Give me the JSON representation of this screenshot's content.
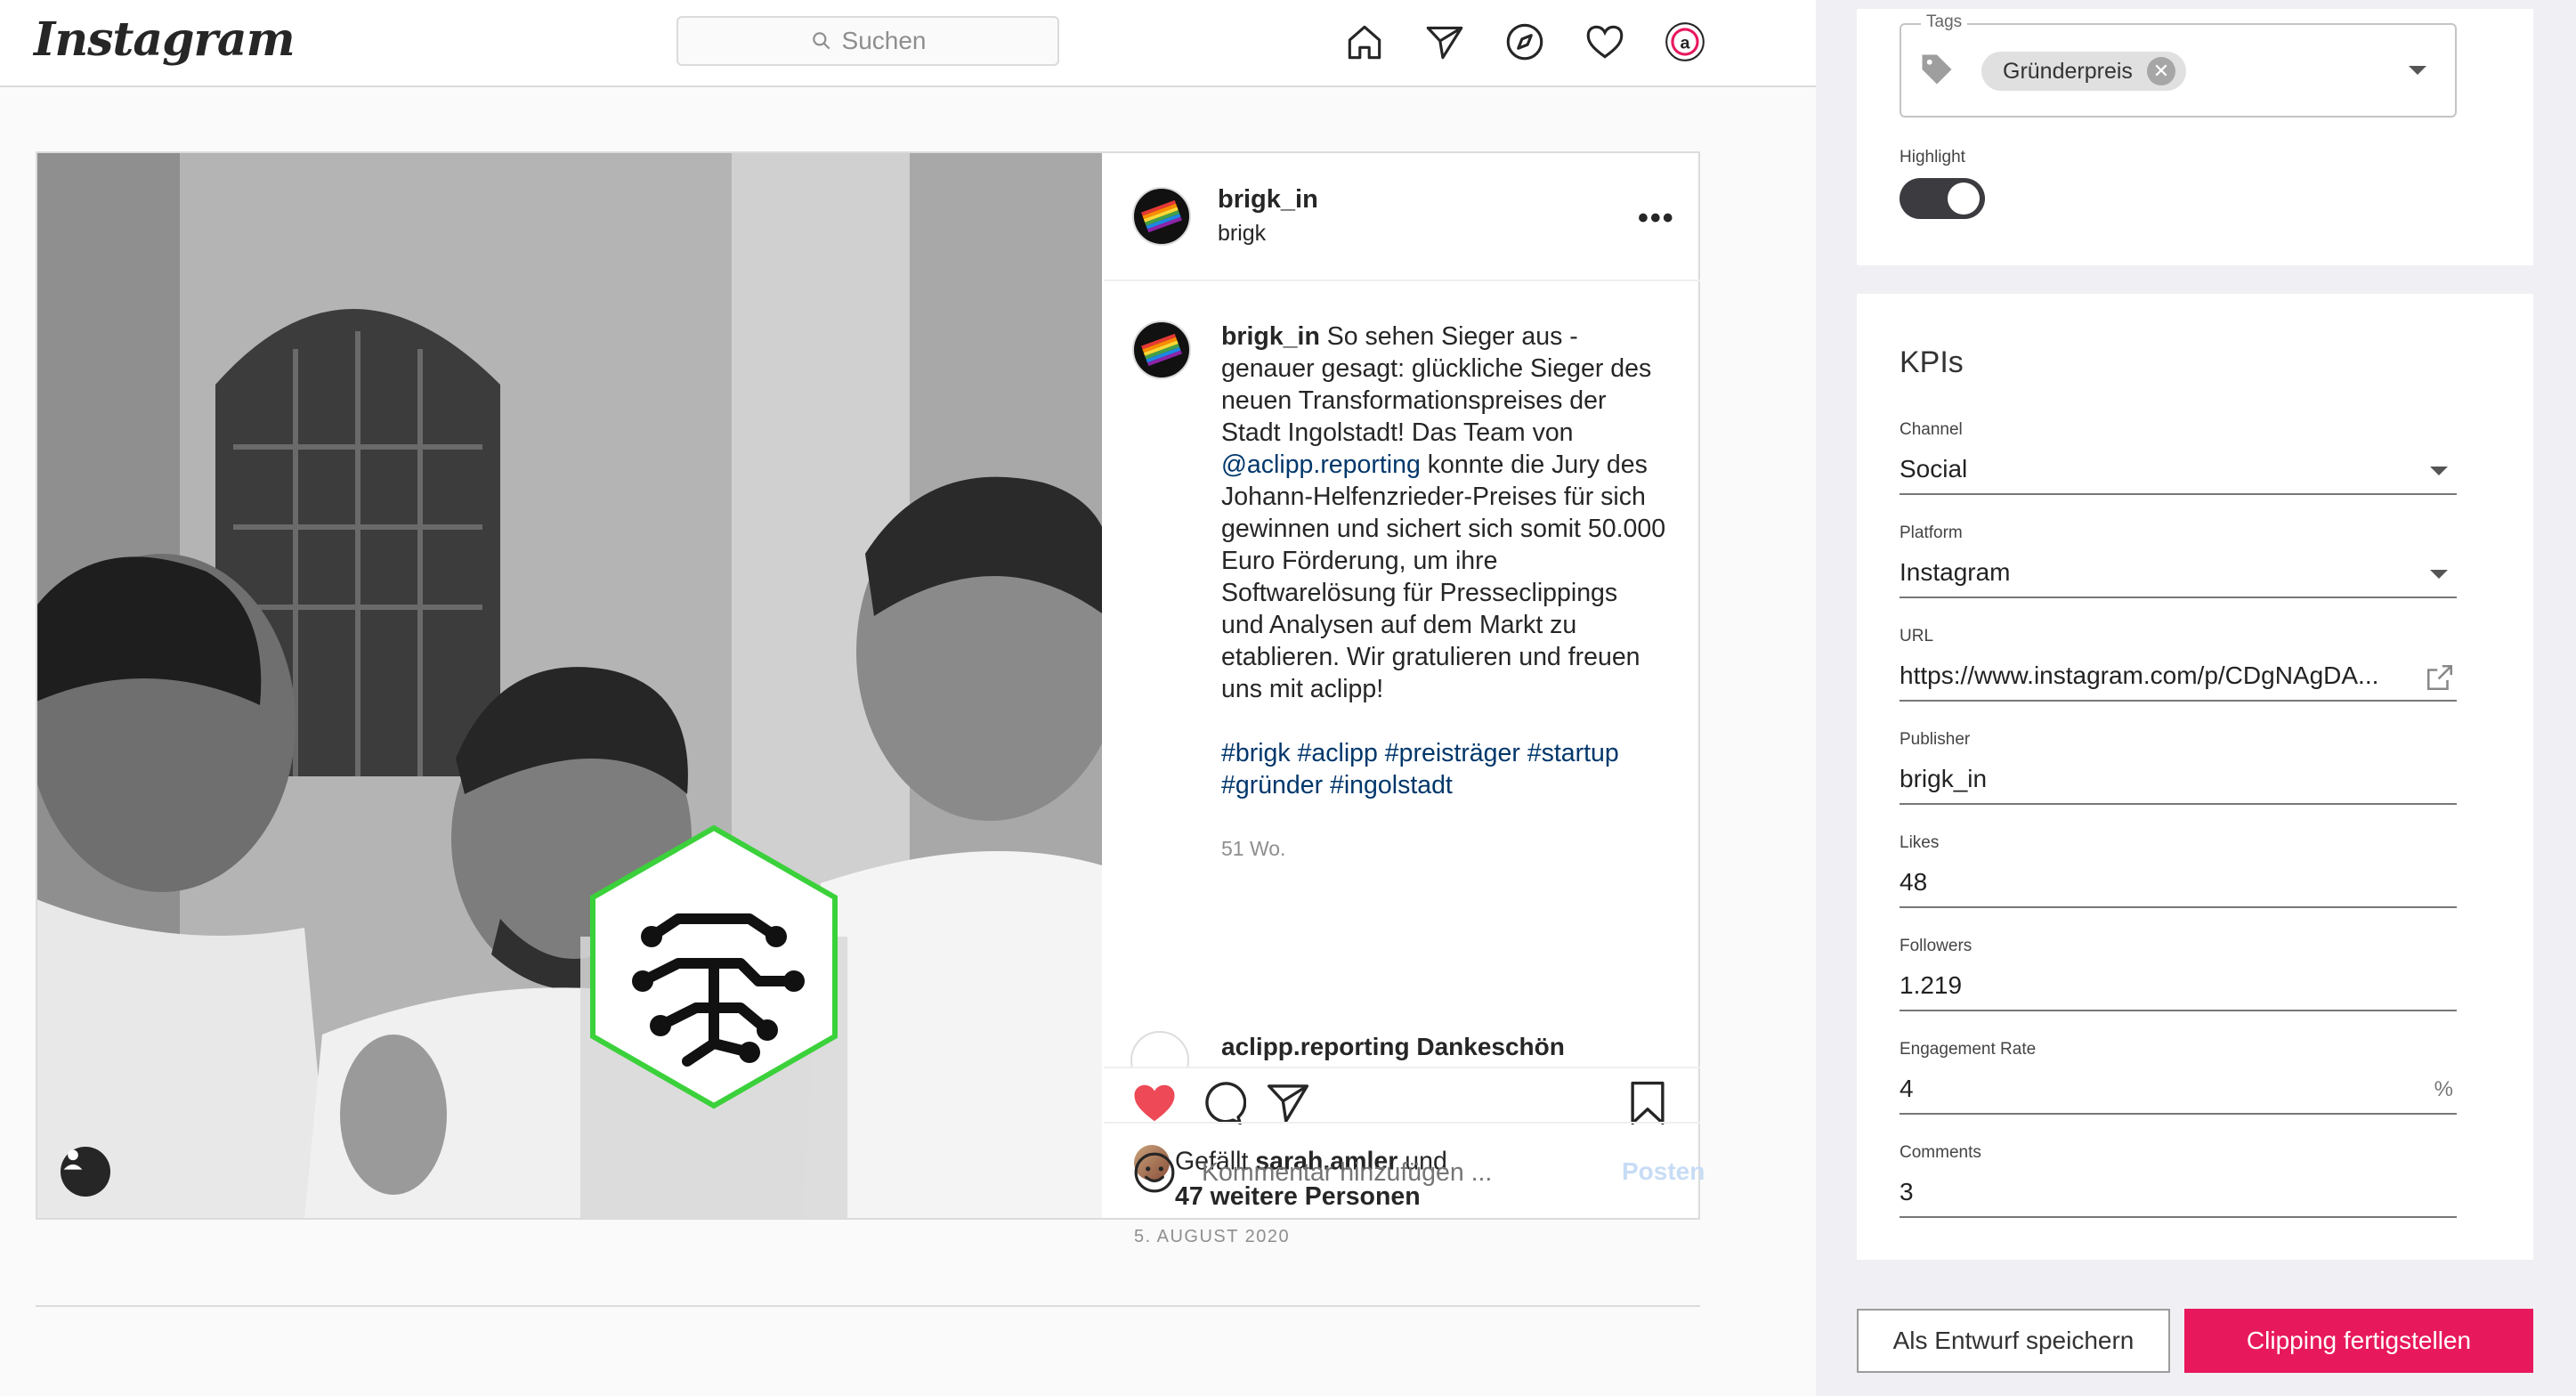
{
  "instagram": {
    "logo": "Instagram",
    "search_placeholder": "Suchen",
    "nav_icons": [
      "home-icon",
      "direct-icon",
      "explore-icon",
      "activity-icon",
      "profile-icon"
    ]
  },
  "post": {
    "username": "brigk_in",
    "location": "brigk",
    "more": "•••",
    "caption": {
      "user": "brigk_in",
      "text_1": " So sehen Sieger aus - genauer gesagt: glückliche Sieger des neuen Transformationspreises der Stadt Ingolstadt! Das Team von ",
      "mention": "@aclipp.reporting",
      "text_2": " konnte die Jury des Johann-Helfenzrieder-Preises für sich gewinnen und sichert sich somit 50.000 Euro Förderung, um ihre Softwarelösung für Presseclippings und Analysen auf dem Markt zu etablieren. Wir gratulieren und freuen uns mit aclipp!",
      "hashtags": "#brigk #aclipp #preisträger #startup #gründer #ingolstadt",
      "age": "51 Wo."
    },
    "next_comment": "aclipp.reporting Dankeschön",
    "likes_prefix": "Gefällt ",
    "likes_user": "sarah.amler",
    "likes_mid": " und",
    "likes_rest": "47 weitere Personen",
    "date": "5. AUGUST 2020",
    "comment_placeholder": "Kommentar hinzufügen ...",
    "post_button": "Posten"
  },
  "panel": {
    "tags_label": "Tags",
    "tag_chip": "Gründerpreis",
    "highlight_label": "Highlight",
    "highlight_on": true,
    "kpi_title": "KPIs",
    "fields": [
      {
        "label": "Channel",
        "value": "Social"
      },
      {
        "label": "Platform",
        "value": "Instagram"
      },
      {
        "label": "URL",
        "value": "https://www.instagram.com/p/CDgNAgDA..."
      },
      {
        "label": "Publisher",
        "value": "brigk_in"
      },
      {
        "label": "Likes",
        "value": "48"
      },
      {
        "label": "Followers",
        "value": "1.219"
      },
      {
        "label": "Engagement Rate",
        "value": "4",
        "suffix": "%"
      },
      {
        "label": "Comments",
        "value": "3"
      }
    ],
    "draft_button": "Als Entwurf speichern",
    "finish_button": "Clipping fertigstellen",
    "accent_color": "#e8185c"
  }
}
